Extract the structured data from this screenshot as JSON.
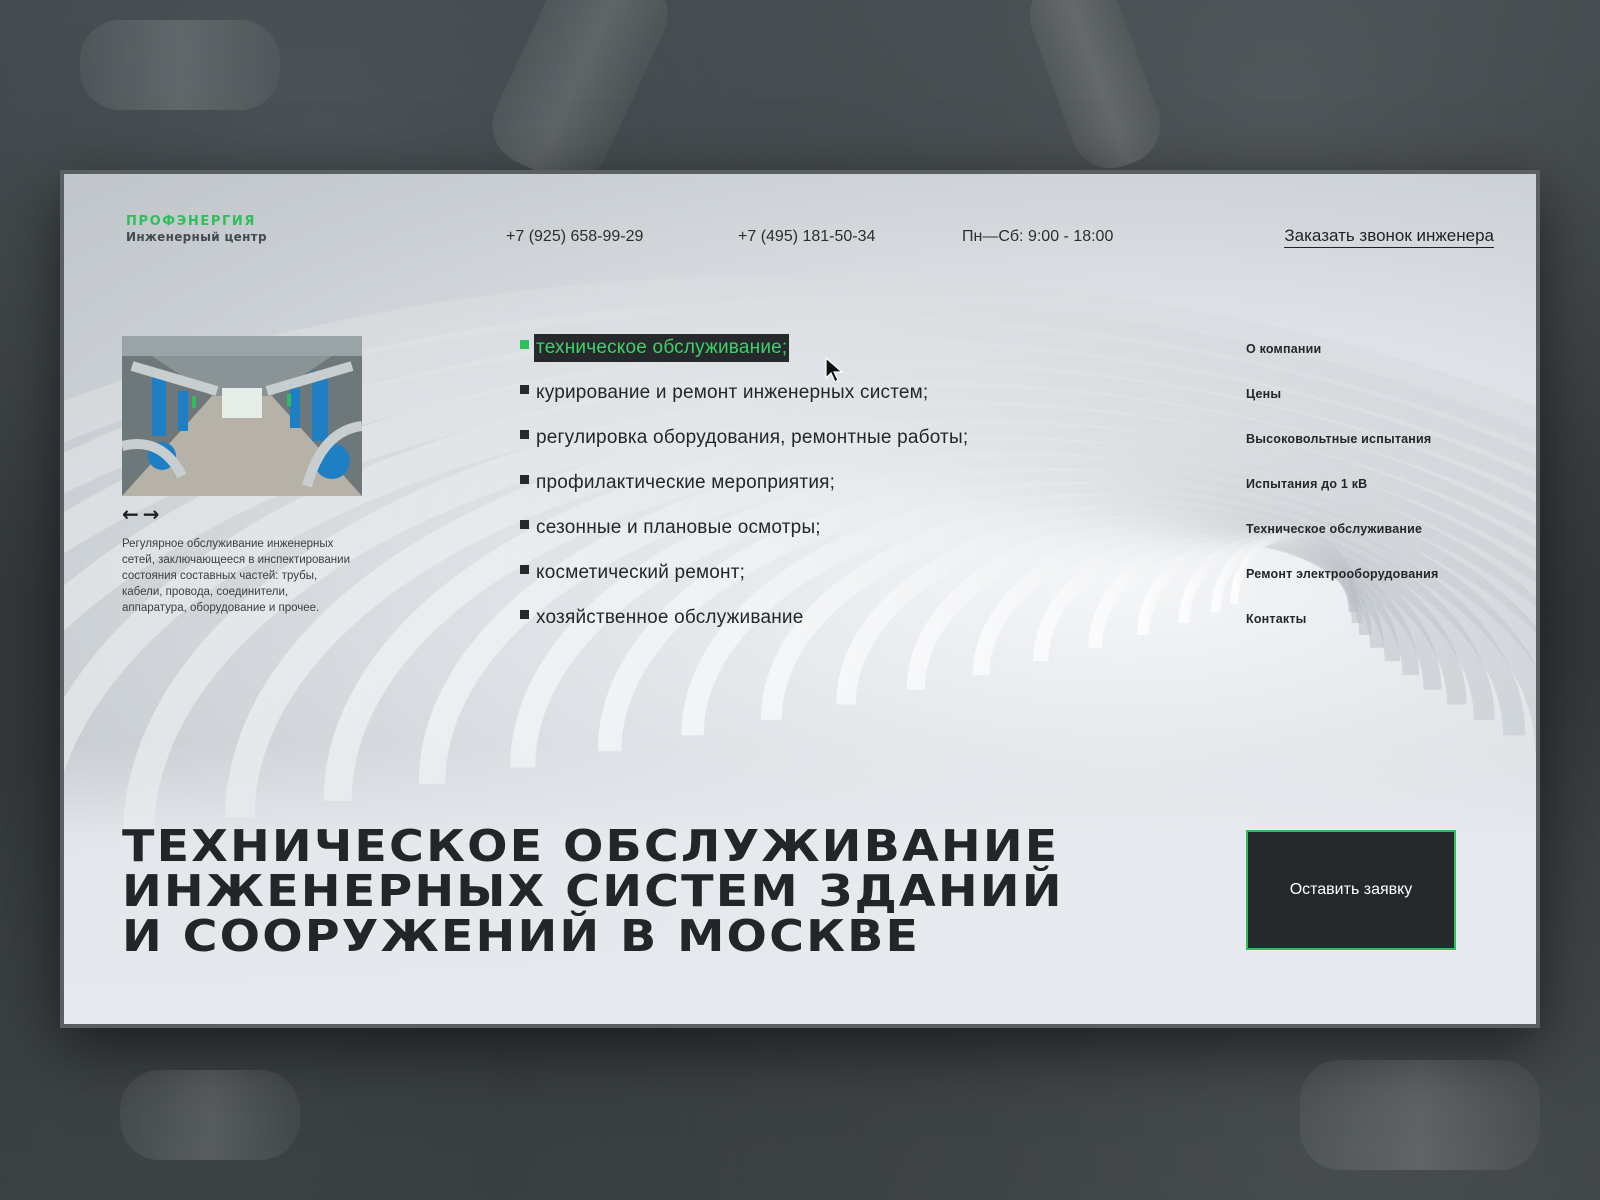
{
  "brand": {
    "name": "ПРОФЭНЕРГИЯ",
    "tagline": "Инженерный центр",
    "accent_color": "#2fbf5a",
    "dark_color": "#26292b"
  },
  "header": {
    "phone_1": "+7 (925) 658-99-29",
    "phone_2": "+7 (495) 181-50-34",
    "hours": "Пн—Сб: 9:00 - 18:00",
    "callback_link": "Заказать звонок инженера"
  },
  "gallery": {
    "prev_icon": "←",
    "next_icon": "→",
    "caption": "Регулярное обслуживание инженерных сетей, заключающееся в инспектировании состояния составных частей: трубы, кабели, провода, соединители, аппаратура, оборудование и прочее."
  },
  "services": [
    {
      "label": "техническое обслуживание;",
      "active": true
    },
    {
      "label": "курирование и ремонт инженерных систем;",
      "active": false
    },
    {
      "label": "регулировка оборудования, ремонтные работы;",
      "active": false
    },
    {
      "label": "профилактические мероприятия;",
      "active": false
    },
    {
      "label": "сезонные и плановые осмотры;",
      "active": false
    },
    {
      "label": "косметический ремонт;",
      "active": false
    },
    {
      "label": "хозяйственное обслуживание",
      "active": false
    }
  ],
  "nav": [
    "О компании",
    "Цены",
    "Высоковольтные испытания",
    "Испытания до 1 кВ",
    "Техническое обслуживание",
    "Ремонт электрооборудования",
    "Контакты"
  ],
  "hero": {
    "title": "ТЕХНИЧЕСКОЕ ОБСЛУЖИВАНИЕ ИНЖЕНЕРНЫХ СИСТЕМ ЗДАНИЙ И СООРУЖЕНИЙ В МОСКВЕ",
    "cta_label": "Оставить заявку"
  }
}
